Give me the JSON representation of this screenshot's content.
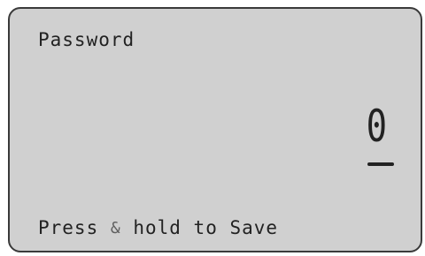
{
  "screen": {
    "title": "Password",
    "value_digit": "0",
    "hint_prefix": "Press ",
    "hint_symbol": "&",
    "hint_suffix": " hold to Save"
  },
  "colors": {
    "lcd_background": "#d0d0d0",
    "lcd_border": "#3a3a3a",
    "text": "#222222"
  }
}
